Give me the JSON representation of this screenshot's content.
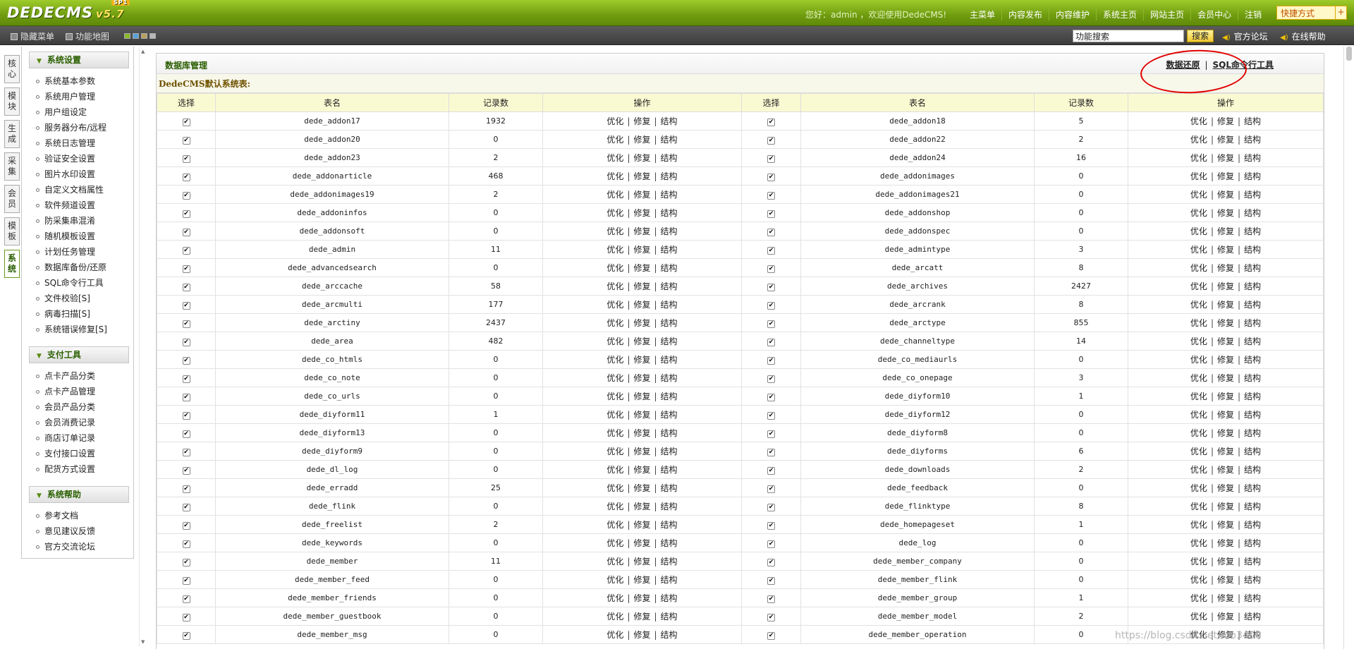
{
  "app": {
    "logo": "DEDECMS",
    "version": "v5.7",
    "badge": "SP1"
  },
  "topbar": {
    "greeting": "您好：admin ，欢迎使用DedeCMS!",
    "nav": [
      "主菜单",
      "内容发布",
      "内容维护",
      "系统主页",
      "网站主页",
      "会员中心",
      "注销"
    ],
    "quick": "快捷方式",
    "quick_plus": "+"
  },
  "toolbar": {
    "hide_menu": "隐藏菜单",
    "func_map": "功能地图",
    "search_value": "功能搜索",
    "search_btn": "搜索",
    "forum": "官方论坛",
    "help": "在线帮助",
    "skin_colors": [
      "#8ab82a",
      "#5aa0d8",
      "#b8a060",
      "#b8b8b8"
    ]
  },
  "vtabs": [
    "核心",
    "模块",
    "生成",
    "采集",
    "会员",
    "模板",
    "系统"
  ],
  "sidebar": {
    "groups": [
      {
        "title": "系统设置",
        "items": [
          "系统基本参数",
          "系统用户管理",
          "用户组设定",
          "服务器分布/远程",
          "系统日志管理",
          "验证安全设置",
          "图片水印设置",
          "自定义文档属性",
          "软件频道设置",
          "防采集串混淆",
          "随机模板设置",
          "计划任务管理",
          "数据库备份/还原",
          "SQL命令行工具",
          "文件校验[S]",
          "病毒扫描[S]",
          "系统错误修复[S]"
        ]
      },
      {
        "title": "支付工具",
        "items": [
          "点卡产品分类",
          "点卡产品管理",
          "会员产品分类",
          "会员消费记录",
          "商店订单记录",
          "支付接口设置",
          "配货方式设置"
        ]
      },
      {
        "title": "系统帮助",
        "items": [
          "参考文档",
          "意见建议反馈",
          "官方交流论坛"
        ]
      }
    ]
  },
  "page": {
    "title": "数据库管理",
    "restore_link": "数据还原",
    "sep": "|",
    "sql_link": "SQL命令行工具",
    "section_title": "DedeCMS默认系统表:"
  },
  "table": {
    "headers": [
      "选择",
      "表名",
      "记录数",
      "操作",
      "选择",
      "表名",
      "记录数",
      "操作"
    ],
    "ops": [
      "优化",
      "修复",
      "结构"
    ],
    "check": "✔",
    "rows": [
      [
        [
          "dede_addon17",
          "1932"
        ],
        [
          "dede_addon18",
          "5"
        ]
      ],
      [
        [
          "dede_addon20",
          "0"
        ],
        [
          "dede_addon22",
          "2"
        ]
      ],
      [
        [
          "dede_addon23",
          "2"
        ],
        [
          "dede_addon24",
          "16"
        ]
      ],
      [
        [
          "dede_addonarticle",
          "468"
        ],
        [
          "dede_addonimages",
          "0"
        ]
      ],
      [
        [
          "dede_addonimages19",
          "2"
        ],
        [
          "dede_addonimages21",
          "0"
        ]
      ],
      [
        [
          "dede_addoninfos",
          "0"
        ],
        [
          "dede_addonshop",
          "0"
        ]
      ],
      [
        [
          "dede_addonsoft",
          "0"
        ],
        [
          "dede_addonspec",
          "0"
        ]
      ],
      [
        [
          "dede_admin",
          "11"
        ],
        [
          "dede_admintype",
          "3"
        ]
      ],
      [
        [
          "dede_advancedsearch",
          "0"
        ],
        [
          "dede_arcatt",
          "8"
        ]
      ],
      [
        [
          "dede_arccache",
          "58"
        ],
        [
          "dede_archives",
          "2427"
        ]
      ],
      [
        [
          "dede_arcmulti",
          "177"
        ],
        [
          "dede_arcrank",
          "8"
        ]
      ],
      [
        [
          "dede_arctiny",
          "2437"
        ],
        [
          "dede_arctype",
          "855"
        ]
      ],
      [
        [
          "dede_area",
          "482"
        ],
        [
          "dede_channeltype",
          "14"
        ]
      ],
      [
        [
          "dede_co_htmls",
          "0"
        ],
        [
          "dede_co_mediaurls",
          "0"
        ]
      ],
      [
        [
          "dede_co_note",
          "0"
        ],
        [
          "dede_co_onepage",
          "3"
        ]
      ],
      [
        [
          "dede_co_urls",
          "0"
        ],
        [
          "dede_diyform10",
          "1"
        ]
      ],
      [
        [
          "dede_diyform11",
          "1"
        ],
        [
          "dede_diyform12",
          "0"
        ]
      ],
      [
        [
          "dede_diyform13",
          "0"
        ],
        [
          "dede_diyform8",
          "0"
        ]
      ],
      [
        [
          "dede_diyform9",
          "0"
        ],
        [
          "dede_diyforms",
          "6"
        ]
      ],
      [
        [
          "dede_dl_log",
          "0"
        ],
        [
          "dede_downloads",
          "2"
        ]
      ],
      [
        [
          "dede_erradd",
          "25"
        ],
        [
          "dede_feedback",
          "0"
        ]
      ],
      [
        [
          "dede_flink",
          "0"
        ],
        [
          "dede_flinktype",
          "8"
        ]
      ],
      [
        [
          "dede_freelist",
          "2"
        ],
        [
          "dede_homepageset",
          "1"
        ]
      ],
      [
        [
          "dede_keywords",
          "0"
        ],
        [
          "dede_log",
          "0"
        ]
      ],
      [
        [
          "dede_member",
          "11"
        ],
        [
          "dede_member_company",
          "0"
        ]
      ],
      [
        [
          "dede_member_feed",
          "0"
        ],
        [
          "dede_member_flink",
          "0"
        ]
      ],
      [
        [
          "dede_member_friends",
          "0"
        ],
        [
          "dede_member_group",
          "1"
        ]
      ],
      [
        [
          "dede_member_guestbook",
          "0"
        ],
        [
          "dede_member_model",
          "2"
        ]
      ],
      [
        [
          "dede_member_msg",
          "0"
        ],
        [
          "dede_member_operation",
          "0"
        ]
      ]
    ]
  },
  "watermark": "https://blog.csdn.net/mo3408"
}
